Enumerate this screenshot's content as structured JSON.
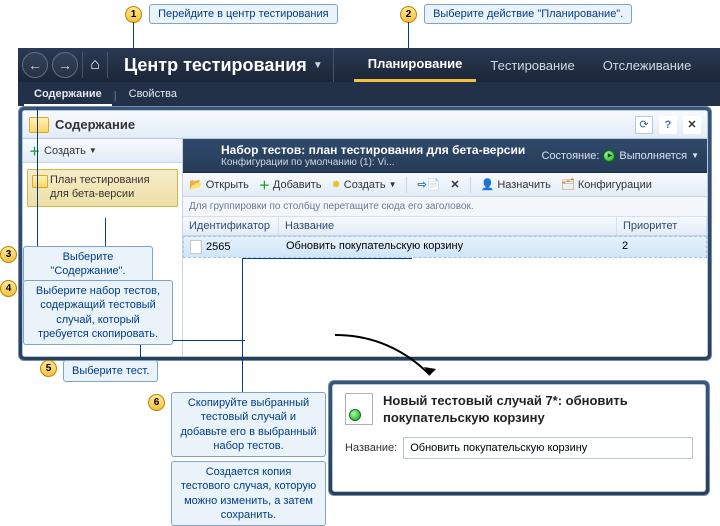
{
  "annotations": {
    "c1": "Перейдите в центр тестирования",
    "c2": "Выберите действие \"Планирование\".",
    "c3": "Выберите \"Содержание\".",
    "c4": "Выберите набор тестов, содержащий тестовый случай, который требуется скопировать.",
    "c5": "Выберите тест.",
    "c6a": "Скопируйте выбранный тестовый случай и добавьте его в выбранный набор тестов.",
    "c6b": "Создается копия тестового случая, которую можно изменить, а затем сохранить."
  },
  "header": {
    "title": "Центр тестирования",
    "tabs": {
      "plan": "Планирование",
      "test": "Тестирование",
      "track": "Отслеживание"
    }
  },
  "subtabs": {
    "contents": "Содержание",
    "properties": "Свойства"
  },
  "panel": {
    "title": "Содержание"
  },
  "leftToolbar": {
    "create": "Создать"
  },
  "tree": {
    "item1": "План тестирования для бета-версии"
  },
  "suite": {
    "title": "Набор тестов: план тестирования для бета-версии",
    "config_label": "Конфигурации по умолчанию (1): Vi...",
    "state_label": "Состояние:",
    "state_value": "Выполняется"
  },
  "toolbar2": {
    "open": "Открыть",
    "add": "Добавить",
    "create": "Создать",
    "assign": "Назначить",
    "configs": "Конфигурации"
  },
  "grid": {
    "group_hint": "Для группировки по столбцу перетащите сюда его заголовок.",
    "cols": {
      "id": "Идентификатор",
      "name": "Название",
      "pri": "Приоритет"
    },
    "row": {
      "id": "2565",
      "name": "Обновить покупательскую корзину",
      "pri": "2"
    }
  },
  "detail": {
    "title": "Новый тестовый случай 7*: обновить покупательскую корзину",
    "name_label": "Название:",
    "name_value": "Обновить покупательскую корзину"
  }
}
